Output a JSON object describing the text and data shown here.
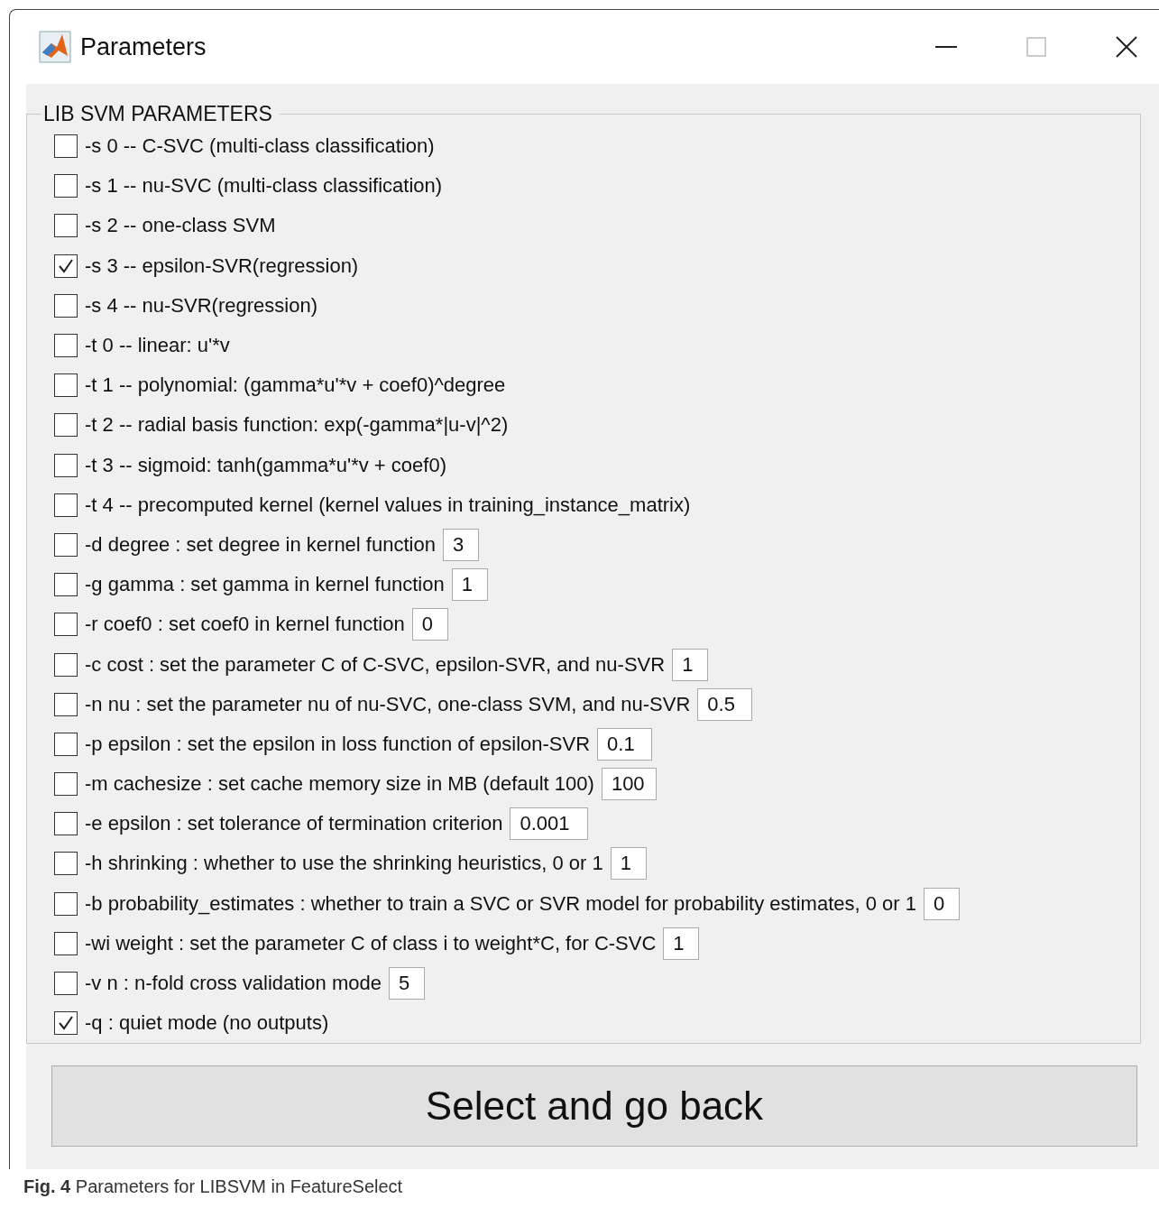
{
  "window": {
    "title": "Parameters"
  },
  "panel": {
    "title": "LIB SVM PARAMETERS",
    "options": [
      {
        "kind": "flag",
        "label": "-s 0 -- C-SVC (multi-class classification)",
        "checked": false
      },
      {
        "kind": "flag",
        "label": "-s 1 -- nu-SVC (multi-class classification)",
        "checked": false
      },
      {
        "kind": "flag",
        "label": "-s 2 -- one-class SVM",
        "checked": false
      },
      {
        "kind": "flag",
        "label": "-s 3 -- epsilon-SVR(regression)",
        "checked": true
      },
      {
        "kind": "flag",
        "label": "-s 4 -- nu-SVR(regression)",
        "checked": false
      },
      {
        "kind": "flag",
        "label": "-t 0 -- linear: u'*v",
        "checked": false
      },
      {
        "kind": "flag",
        "label": "-t 1 -- polynomial: (gamma*u'*v + coef0)^degree",
        "checked": false
      },
      {
        "kind": "flag",
        "label": "-t 2 -- radial basis function: exp(-gamma*|u-v|^2)",
        "checked": false
      },
      {
        "kind": "flag",
        "label": "-t 3 -- sigmoid: tanh(gamma*u'*v + coef0)",
        "checked": false
      },
      {
        "kind": "flag",
        "label": "-t 4 -- precomputed kernel (kernel values in training_instance_matrix)",
        "checked": false
      },
      {
        "kind": "value",
        "label": "-d degree : set degree in kernel function",
        "checked": false,
        "value": "3"
      },
      {
        "kind": "value",
        "label": "-g gamma : set gamma in kernel function",
        "checked": false,
        "value": "1"
      },
      {
        "kind": "value",
        "label": "-r coef0 : set coef0 in kernel function",
        "checked": false,
        "value": "0"
      },
      {
        "kind": "value",
        "label": "-c cost : set the parameter C of C-SVC, epsilon-SVR, and nu-SVR",
        "checked": false,
        "value": "1"
      },
      {
        "kind": "value",
        "label": "-n nu : set the parameter nu of nu-SVC, one-class SVM, and nu-SVR",
        "checked": false,
        "value": "0.5"
      },
      {
        "kind": "value",
        "label": "-p epsilon : set the epsilon in loss function of epsilon-SVR",
        "checked": false,
        "value": "0.1"
      },
      {
        "kind": "value",
        "label": "-m cachesize : set cache memory size in MB (default 100)",
        "checked": false,
        "value": "100"
      },
      {
        "kind": "value",
        "label": "-e epsilon : set tolerance of termination criterion",
        "checked": false,
        "value": "0.001"
      },
      {
        "kind": "value",
        "label": "-h shrinking : whether to use the shrinking heuristics, 0 or 1",
        "checked": false,
        "value": "1"
      },
      {
        "kind": "value",
        "label": "-b probability_estimates : whether to train a SVC or SVR model for probability estimates, 0 or 1",
        "checked": false,
        "value": "0"
      },
      {
        "kind": "value",
        "label": "-wi weight : set the parameter C of class i to weight*C, for C-SVC",
        "checked": false,
        "value": "1"
      },
      {
        "kind": "value",
        "label": "-v n : n-fold cross validation mode",
        "checked": false,
        "value": "5"
      },
      {
        "kind": "flag",
        "label": "-q : quiet mode (no outputs)",
        "checked": true
      }
    ]
  },
  "button": "Select and go back",
  "caption": "**Fig. 4** Parameters for LIBSVM in FeatureSelect"
}
